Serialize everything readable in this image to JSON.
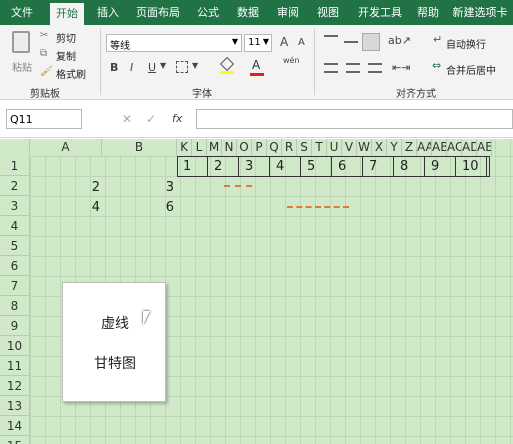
{
  "tabs": [
    "文件",
    "开始",
    "插入",
    "页面布局",
    "公式",
    "数据",
    "审阅",
    "视图",
    "开发工具",
    "帮助",
    "新建选项卡"
  ],
  "clipboard": {
    "paste": "粘贴",
    "cut": "剪切",
    "copy": "复制",
    "format_painter": "格式刷",
    "group": "剪贴板"
  },
  "font": {
    "name": "等线",
    "size": "11",
    "group": "字体",
    "bold": "B",
    "italic": "I",
    "underline": "U",
    "font_color": "A",
    "wen": "wén",
    "bigger": "A",
    "smaller": "A"
  },
  "alignment": {
    "wrap": "自动换行",
    "merge": "合并后居中",
    "group": "对齐方式"
  },
  "formula_bar": {
    "cell_ref": "Q11",
    "fx": "fx"
  },
  "columns_left": [
    "A",
    "B"
  ],
  "columns_narrow": [
    "K",
    "L",
    "M",
    "N",
    "O",
    "P",
    "Q",
    "R",
    "S",
    "T",
    "U",
    "V",
    "W",
    "X",
    "Y",
    "Z",
    "AA",
    "AB",
    "AC",
    "AD",
    "AE"
  ],
  "rows": [
    "1",
    "2",
    "3",
    "4",
    "5",
    "6",
    "7",
    "8",
    "9",
    "10",
    "11",
    "12",
    "13",
    "14",
    "15"
  ],
  "cells": {
    "A2": "2",
    "B2": "3",
    "A3": "4",
    "B3": "6"
  },
  "timeline": [
    "1",
    "2",
    "3",
    "4",
    "5",
    "6",
    "7",
    "8",
    "9",
    "10"
  ],
  "popup": {
    "item1": "虚线",
    "item2": "甘特图"
  },
  "colors": {
    "green": "#217346",
    "sheet_bg": "#cfe9c9",
    "dash": "#e07b39"
  }
}
